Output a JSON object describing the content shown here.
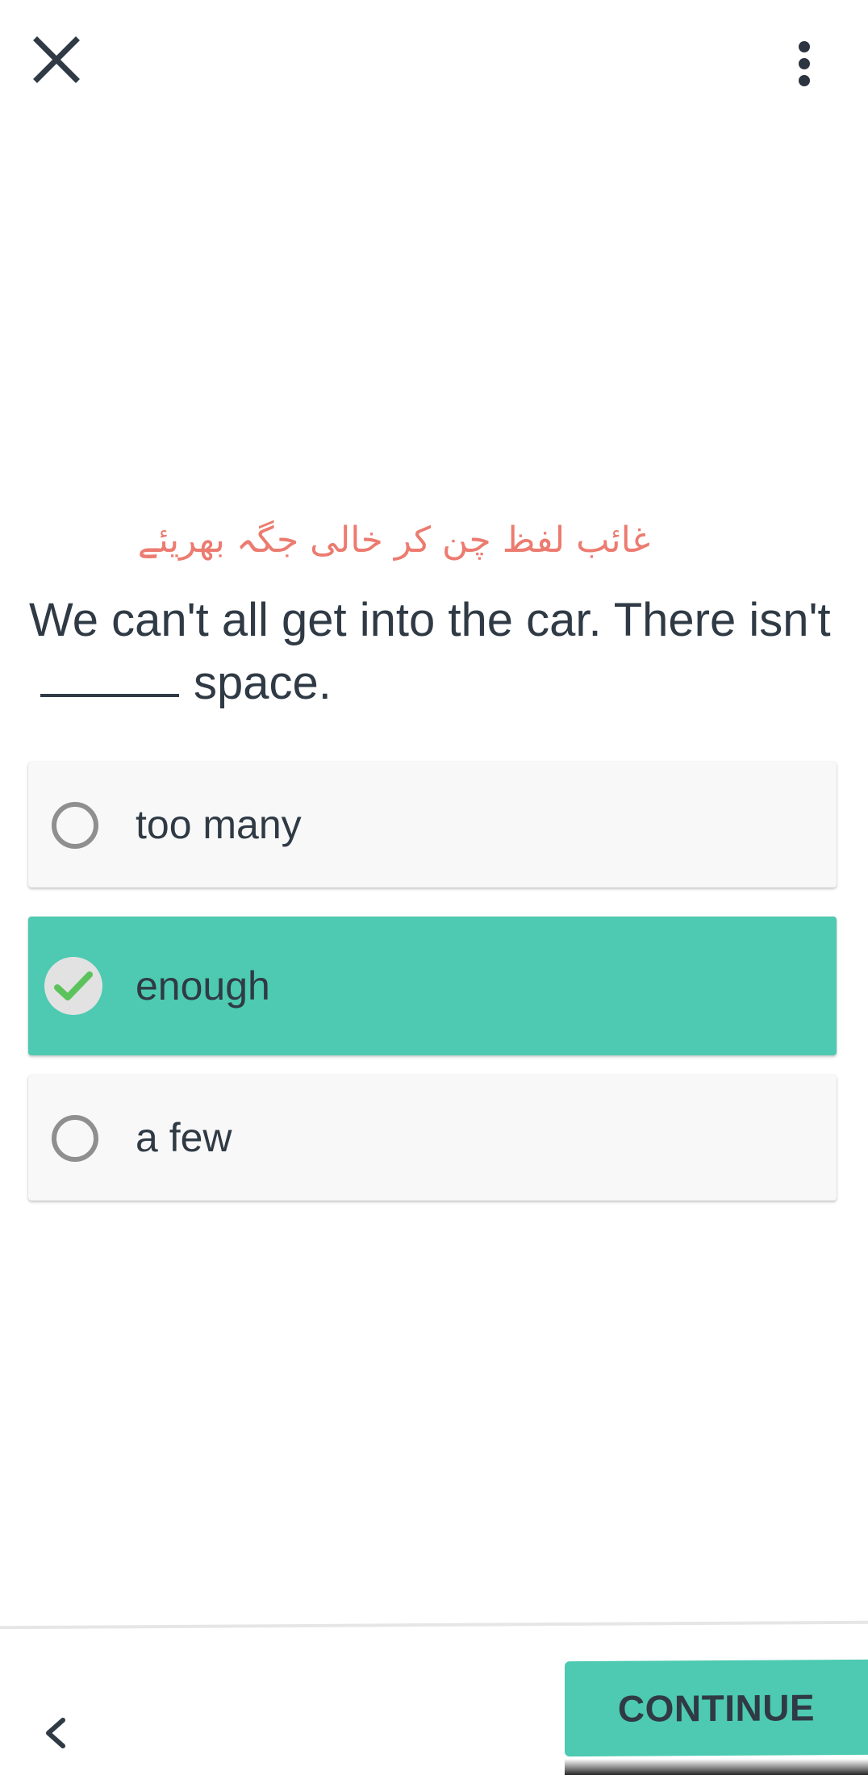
{
  "header": {
    "close_icon": "close-icon",
    "more_icon": "more-vertical-icon"
  },
  "exercise": {
    "instruction": "غائب لفظ چن کر خالی جگہ بھریئے",
    "sentence_before": "We can't all get into the car. There isn't",
    "sentence_after": "space."
  },
  "options": [
    {
      "label": "too many",
      "selected": false
    },
    {
      "label": "enough",
      "selected": true
    },
    {
      "label": "a few",
      "selected": false
    }
  ],
  "footer": {
    "back_icon": "chevron-left-icon",
    "continue_label": "CONTINUE"
  },
  "colors": {
    "accent": "#4dcab1",
    "instruction": "#ec7b70",
    "text": "#2f3a45",
    "check": "#5cc35c"
  }
}
